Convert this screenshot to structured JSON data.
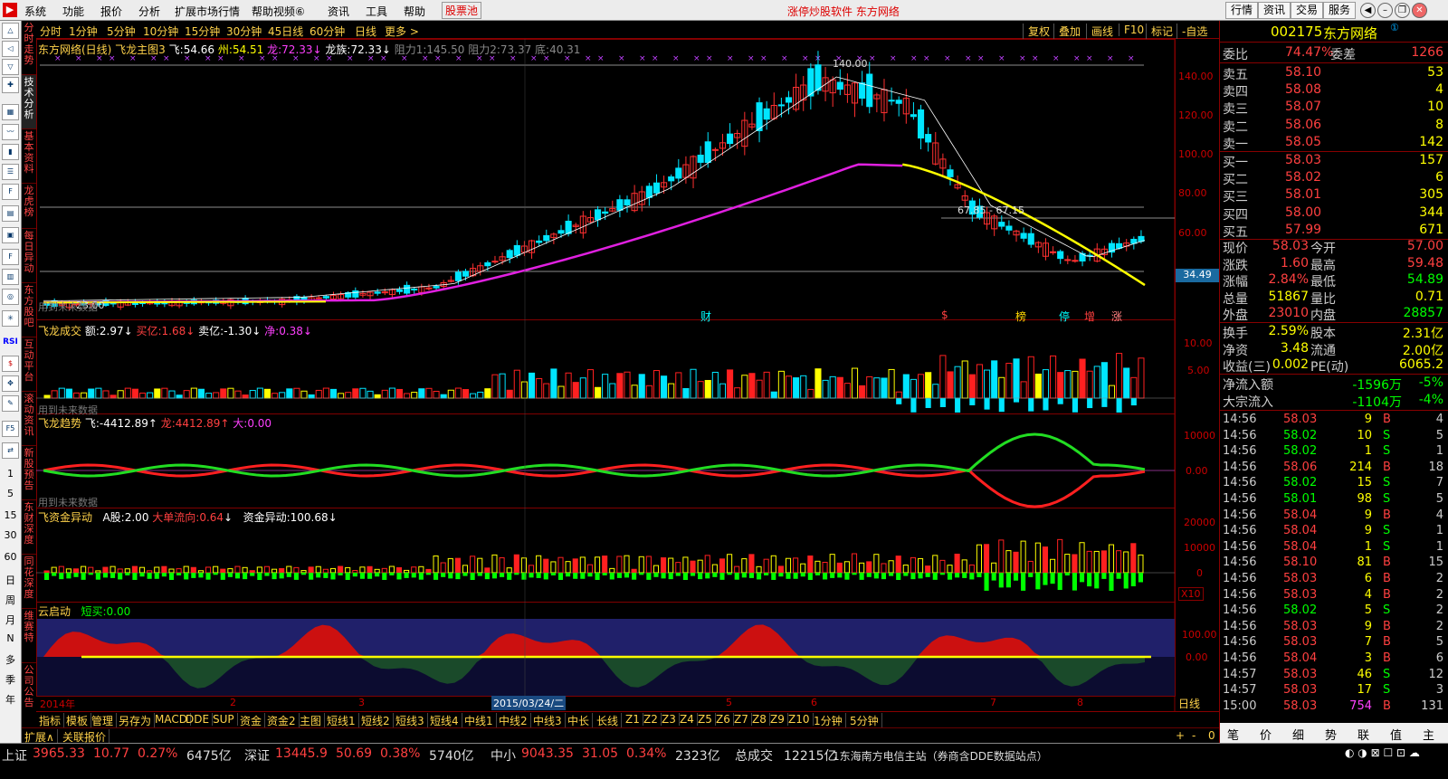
{
  "menu": {
    "items": [
      "系统",
      "功能",
      "报价",
      "分析",
      "扩展市场行情",
      "帮助视频⑥",
      "资讯",
      "工具",
      "帮助"
    ],
    "highlight": "股票池",
    "center": "涨停炒股软件    东方网络",
    "buttons": [
      "行情",
      "资讯",
      "交易",
      "服务"
    ]
  },
  "left_icons": [
    "RSI",
    "1",
    "5",
    "15",
    "30",
    "60",
    "日",
    "周",
    "月",
    "N",
    "多",
    "季",
    "年"
  ],
  "side_tabs": [
    "分时走势",
    "技术分析",
    "基本资料",
    "龙虎榜",
    "每日异动",
    "东方股吧",
    "互动平台",
    "滚动资讯",
    "新股预告",
    "东财深度",
    "同花深度",
    "维赛特",
    "公司公告"
  ],
  "period_bar": {
    "left": [
      "分时",
      "1分钟",
      "5分钟",
      "10分钟",
      "15分钟",
      "30分钟",
      "45日线",
      "60分钟",
      "日线",
      "更多 >"
    ],
    "right": [
      "复权",
      "叠加",
      "画线",
      "F10",
      "标记",
      "-自选"
    ]
  },
  "main_chart": {
    "title": "东方网络(日线) 飞龙主图3",
    "legend": [
      {
        "k": "飞:",
        "v": "54.66",
        "c": "#ffffff"
      },
      {
        "k": "州:",
        "v": "54.51",
        "c": "#ffff00"
      },
      {
        "k": "龙:",
        "v": "72.33",
        "c": "#ff40ff"
      },
      {
        "k": "龙族:",
        "v": "72.33",
        "c": "#ffffff"
      }
    ],
    "resist": "阻力1:145.50 阻力2:73.37 底:40.31",
    "high_label": "140.00",
    "low_label": "23.00",
    "mid_label": "67.85 - 67.15",
    "hint": "用到未来数据",
    "yticks": [
      "140.00",
      "120.00",
      "100.00",
      "80.00",
      "60.00"
    ],
    "price_tag": "34.49",
    "events": [
      {
        "t": "财",
        "c": "#00ffff"
      },
      {
        "t": "$",
        "c": "#ff4040"
      },
      {
        "t": "榜",
        "c": "#ffd700"
      },
      {
        "t": "停",
        "c": "#00ffff"
      },
      {
        "t": "增",
        "c": "#ff4040"
      },
      {
        "t": "涨",
        "c": "#ff8080"
      }
    ]
  },
  "vol_panel": {
    "title": "飞龙成交",
    "legend": [
      {
        "k": "额:",
        "v": "2.97",
        "c": "#ffffff"
      },
      {
        "k": "买亿:",
        "v": "1.68",
        "c": "#ff4040"
      },
      {
        "k": "卖亿:",
        "v": "-1.30",
        "c": "#ffffff"
      },
      {
        "k": "净:",
        "v": "0.38",
        "c": "#ff40ff"
      }
    ],
    "hint": "用到未来数据",
    "yticks": [
      "10.00",
      "5.00"
    ]
  },
  "trend_panel": {
    "title": "飞龙趋势",
    "legend": [
      {
        "k": "飞:",
        "v": "-4412.89",
        "c": "#ffffff"
      },
      {
        "k": "龙:",
        "v": "4412.89",
        "c": "#ff4040"
      },
      {
        "k": "大:",
        "v": "0.00",
        "c": "#ffff00"
      }
    ],
    "hint": "用到未来数据",
    "yticks": [
      "10000",
      "0.00"
    ]
  },
  "fund_panel": {
    "title": "飞资金异动",
    "legend": [
      {
        "k": "A股:",
        "v": "2.00",
        "c": "#ffffff"
      },
      {
        "k": "大单流向:",
        "v": "0.64",
        "c": "#ff4040"
      },
      {
        "k": "资金异动:",
        "v": "100.68",
        "c": "#ffffff"
      }
    ],
    "yticks": [
      "20000",
      "10000",
      "0"
    ],
    "unit": "X10"
  },
  "cloud_panel": {
    "title": "云启动",
    "legend": [
      {
        "k": "短买:",
        "v": "0.00",
        "c": "#00ff00"
      }
    ],
    "yticks": [
      "100.00",
      "0.00"
    ]
  },
  "date_axis": {
    "labels": [
      "2014年",
      "2",
      "3",
      "4",
      "5",
      "6",
      "7",
      "8"
    ],
    "cursor": "2015/03/24/二",
    "period": "日线"
  },
  "bottom_tabs": [
    "指标",
    "模板",
    "管理",
    "另存为",
    "MACD",
    "DDE",
    "SUP",
    "资金",
    "资金2",
    "主图",
    "短线1",
    "短线2",
    "短线3",
    "短线4",
    "中线1",
    "中线2",
    "中线3",
    "中长",
    "长线",
    "Z1",
    "Z2",
    "Z3",
    "Z4",
    "Z5",
    "Z6",
    "Z7",
    "Z8",
    "Z9",
    "Z10",
    "1分钟",
    "5分钟"
  ],
  "bottom_tabs2": [
    "扩展∧",
    "关联报价"
  ],
  "quote": {
    "code": "002175",
    "name": "东方网络",
    "weibi": {
      "label": "委比",
      "pct": "74.47%",
      "label2": "委差",
      "val": "1266"
    },
    "asks": [
      {
        "l": "卖五",
        "p": "58.10",
        "v": "53"
      },
      {
        "l": "卖四",
        "p": "58.08",
        "v": "4"
      },
      {
        "l": "卖三",
        "p": "58.07",
        "v": "10"
      },
      {
        "l": "卖二",
        "p": "58.06",
        "v": "8"
      },
      {
        "l": "卖一",
        "p": "58.05",
        "v": "142"
      }
    ],
    "bids": [
      {
        "l": "买一",
        "p": "58.03",
        "v": "157"
      },
      {
        "l": "买二",
        "p": "58.02",
        "v": "6"
      },
      {
        "l": "买三",
        "p": "58.01",
        "v": "305"
      },
      {
        "l": "买四",
        "p": "58.00",
        "v": "344"
      },
      {
        "l": "买五",
        "p": "57.99",
        "v": "671"
      }
    ],
    "stats": [
      {
        "l1": "现价",
        "v1": "58.03",
        "l2": "今开",
        "v2": "57.00",
        "c1": "#ff4040",
        "c2": "#ff4040"
      },
      {
        "l1": "涨跌",
        "v1": "1.60",
        "l2": "最高",
        "v2": "59.48",
        "c1": "#ff4040",
        "c2": "#ff4040"
      },
      {
        "l1": "涨幅",
        "v1": "2.84%",
        "l2": "最低",
        "v2": "54.89",
        "c1": "#ff4040",
        "c2": "#00ff00"
      },
      {
        "l1": "总量",
        "v1": "51867",
        "l2": "量比",
        "v2": "0.71",
        "c1": "#ffff00",
        "c2": "#ffff00"
      },
      {
        "l1": "外盘",
        "v1": "23010",
        "l2": "内盘",
        "v2": "28857",
        "c1": "#ff4040",
        "c2": "#00ff00"
      }
    ],
    "stats2": [
      {
        "l1": "换手",
        "v1": "2.59%",
        "l2": "股本",
        "v2": "2.31亿",
        "c1": "#ffff00",
        "c2": "#ffff00"
      },
      {
        "l1": "净资",
        "v1": "3.48",
        "l2": "流通",
        "v2": "2.00亿",
        "c1": "#ffff00",
        "c2": "#ffff00"
      },
      {
        "l1": "收益(三)",
        "v1": "0.002",
        "l2": "PE(动)",
        "v2": "6065.2",
        "c1": "#ffff00",
        "c2": "#ffff00"
      }
    ],
    "flows": [
      {
        "l": "净流入额",
        "v": "-1596万",
        "p": "-5%"
      },
      {
        "l": "大宗流入",
        "v": "-1104万",
        "p": "-4%"
      }
    ],
    "ticks": [
      {
        "t": "14:56",
        "p": "58.03",
        "v": "9",
        "d": "B",
        "n": "4"
      },
      {
        "t": "14:56",
        "p": "58.02",
        "v": "10",
        "d": "S",
        "n": "5"
      },
      {
        "t": "14:56",
        "p": "58.02",
        "v": "1",
        "d": "S",
        "n": "1"
      },
      {
        "t": "14:56",
        "p": "58.06",
        "v": "214",
        "d": "B",
        "n": "18"
      },
      {
        "t": "14:56",
        "p": "58.02",
        "v": "15",
        "d": "S",
        "n": "7"
      },
      {
        "t": "14:56",
        "p": "58.01",
        "v": "98",
        "d": "S",
        "n": "5"
      },
      {
        "t": "14:56",
        "p": "58.04",
        "v": "9",
        "d": "B",
        "n": "4"
      },
      {
        "t": "14:56",
        "p": "58.04",
        "v": "9",
        "d": "S",
        "n": "1"
      },
      {
        "t": "14:56",
        "p": "58.04",
        "v": "1",
        "d": "S",
        "n": "1"
      },
      {
        "t": "14:56",
        "p": "58.10",
        "v": "81",
        "d": "B",
        "n": "15"
      },
      {
        "t": "14:56",
        "p": "58.03",
        "v": "6",
        "d": "B",
        "n": "2"
      },
      {
        "t": "14:56",
        "p": "58.03",
        "v": "4",
        "d": "B",
        "n": "2"
      },
      {
        "t": "14:56",
        "p": "58.02",
        "v": "5",
        "d": "S",
        "n": "2"
      },
      {
        "t": "14:56",
        "p": "58.03",
        "v": "9",
        "d": "B",
        "n": "2"
      },
      {
        "t": "14:56",
        "p": "58.03",
        "v": "7",
        "d": "B",
        "n": "5"
      },
      {
        "t": "14:56",
        "p": "58.04",
        "v": "3",
        "d": "B",
        "n": "6"
      },
      {
        "t": "14:57",
        "p": "58.03",
        "v": "46",
        "d": "S",
        "n": "12"
      },
      {
        "t": "14:57",
        "p": "58.03",
        "v": "17",
        "d": "S",
        "n": "3"
      },
      {
        "t": "15:00",
        "p": "58.03",
        "v": "754",
        "d": "B",
        "n": "131"
      }
    ],
    "tabs": [
      "笔",
      "价",
      "细",
      "势",
      "联",
      "值",
      "主"
    ]
  },
  "status": {
    "items": [
      {
        "l": "上证",
        "v": "3965.33",
        "c": "10.77",
        "p": "0.27%",
        "a": "6475亿"
      },
      {
        "l": "深证",
        "v": "13445.9",
        "c": "50.69",
        "p": "0.38%",
        "a": "5740亿"
      },
      {
        "l": "中小",
        "v": "9043.35",
        "c": "31.05",
        "p": "0.34%",
        "a": "2323亿"
      }
    ],
    "total_label": "总成交",
    "total": "12215亿",
    "site": "1东海南方电信主站（券商含DDE数据站点）"
  }
}
